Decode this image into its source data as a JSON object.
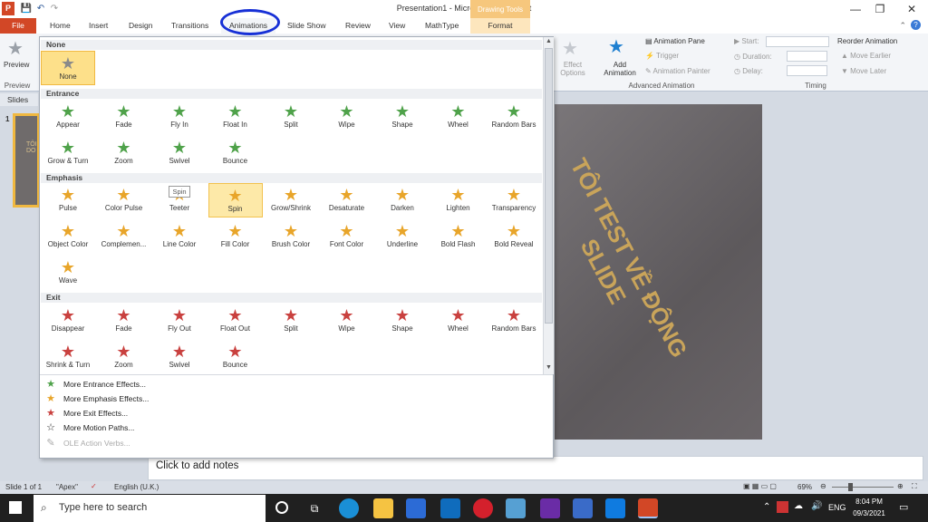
{
  "window": {
    "title": "Presentation1 - Microsoft PowerPoint",
    "app_icon": "P"
  },
  "qat": {
    "save": "💾",
    "undo": "↶",
    "redo": "↷"
  },
  "tabs": {
    "file": "File",
    "home": "Home",
    "insert": "Insert",
    "design": "Design",
    "transitions": "Transitions",
    "animations": "Animations",
    "slideshow": "Slide Show",
    "review": "Review",
    "view": "View",
    "mathtype": "MathType",
    "format": "Format",
    "drawing_tools": "Drawing Tools"
  },
  "ribbon": {
    "preview": "Preview",
    "preview_group": "Preview",
    "effect_options": "Effect Options",
    "add_animation": "Add Animation",
    "animation_pane": "Animation Pane",
    "trigger": "Trigger",
    "animation_painter": "Animation Painter",
    "advanced_group": "Advanced Animation",
    "start": "Start:",
    "duration": "Duration:",
    "delay": "Delay:",
    "timing_group": "Timing",
    "reorder": "Reorder Animation",
    "move_earlier": "Move Earlier",
    "move_later": "Move Later"
  },
  "left_pane": {
    "slides_tab": "Slides",
    "slide_number": "1",
    "thumb_text": "TÔI DO"
  },
  "gallery": {
    "sections": {
      "none": "None",
      "entrance": "Entrance",
      "emphasis": "Emphasis",
      "exit": "Exit"
    },
    "none_label": "None",
    "entrance": [
      "Appear",
      "Fade",
      "Fly In",
      "Float In",
      "Split",
      "Wipe",
      "Shape",
      "Wheel",
      "Random Bars",
      "Grow & Turn",
      "Zoom",
      "Swivel",
      "Bounce"
    ],
    "emphasis": [
      "Pulse",
      "Color Pulse",
      "Teeter",
      "Spin",
      "Grow/Shrink",
      "Desaturate",
      "Darken",
      "Lighten",
      "Transparency",
      "Object Color",
      "Complemen...",
      "Line Color",
      "Fill Color",
      "Brush Color",
      "Font Color",
      "Underline",
      "Bold Flash",
      "Bold Reveal",
      "Wave"
    ],
    "exit": [
      "Disappear",
      "Fade",
      "Fly Out",
      "Float Out",
      "Split",
      "Wipe",
      "Shape",
      "Wheel",
      "Random Bars",
      "Shrink & Turn",
      "Zoom",
      "Swivel",
      "Bounce"
    ],
    "tooltip": "Spin",
    "more": {
      "entrance": "More Entrance Effects...",
      "emphasis": "More Emphasis Effects...",
      "exit": "More Exit Effects...",
      "motion": "More Motion Paths...",
      "ole": "OLE Action Verbs..."
    }
  },
  "slide": {
    "text": "TÔI TEST VỀ ĐỘNG SLIDE"
  },
  "notes": {
    "placeholder": "Click to add notes"
  },
  "status": {
    "slide": "Slide 1 of 1",
    "theme": "\"Apex\"",
    "language": "English (U.K.)",
    "zoom": "69%"
  },
  "taskbar": {
    "search_placeholder": "Type here to search",
    "lang": "ENG",
    "time": "8:04 PM",
    "date": "09/3/2021"
  },
  "colors": {
    "file_tab": "#d24726",
    "highlight": "#fde08a",
    "annotation_circle": "#1730d6"
  }
}
